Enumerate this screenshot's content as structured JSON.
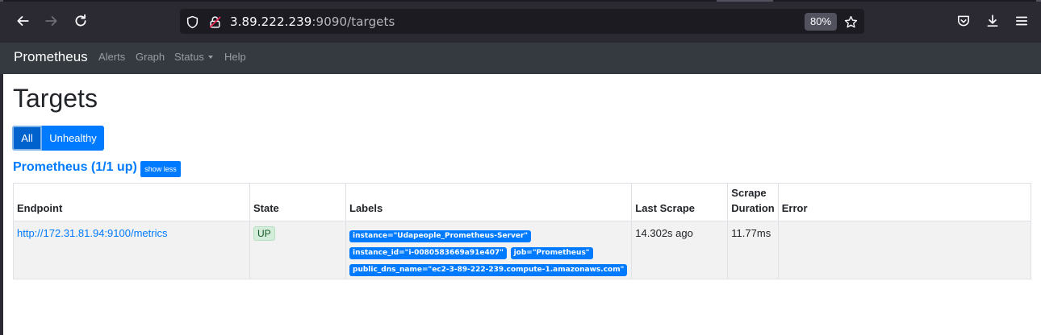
{
  "browser": {
    "url_host": "3.89.222.239",
    "url_rest": ":9090/targets",
    "zoom": "80%"
  },
  "navbar": {
    "brand": "Prometheus",
    "links": [
      "Alerts",
      "Graph",
      "Status",
      "Help"
    ]
  },
  "page": {
    "title": "Targets",
    "filters": {
      "all": "All",
      "unhealthy": "Unhealthy"
    }
  },
  "job": {
    "header": "Prometheus (1/1 up)",
    "toggle": "show less",
    "columns": [
      "Endpoint",
      "State",
      "Labels",
      "Last Scrape",
      "Scrape Duration",
      "Error"
    ],
    "rows": [
      {
        "endpoint": "http://172.31.81.94:9100/metrics",
        "state": "UP",
        "labels": [
          "instance=\"Udapeople_Prometheus-Server\"",
          "instance_id=\"i-0080583669a91e407\"",
          "job=\"Prometheus\"",
          "public_dns_name=\"ec2-3-89-222-239.compute-1.amazonaws.com\""
        ],
        "last_scrape": "14.302s ago",
        "scrape_duration": "11.77ms",
        "error": ""
      }
    ]
  }
}
